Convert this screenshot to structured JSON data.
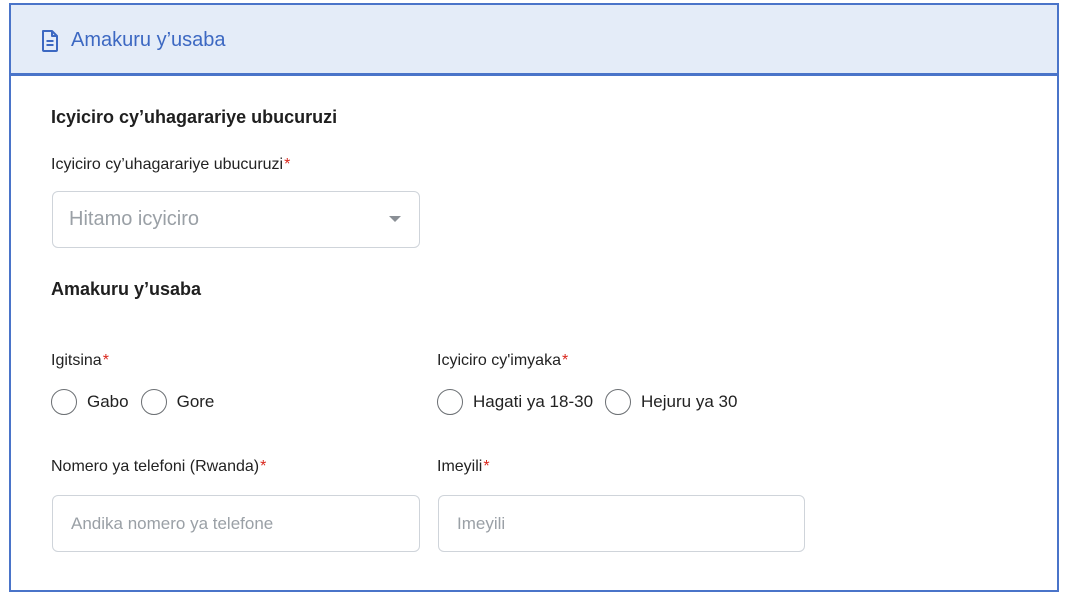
{
  "header": {
    "title": "Amakuru y’usaba",
    "icon": "document-icon",
    "accent_color": "#4a74c9",
    "background_color": "#e4ecf8"
  },
  "section_sector": {
    "title": "Icyiciro cy’uhagarariye ubucuruzi",
    "field_label": "Icyiciro cy’uhagarariye ubucuruzi",
    "required_mark": "*",
    "select_placeholder": "Hitamo icyiciro"
  },
  "section_applicant": {
    "title": "Amakuru y’usaba",
    "gender": {
      "label": "Igitsina",
      "required_mark": "*",
      "options": [
        "Gabo",
        "Gore"
      ]
    },
    "age_group": {
      "label": "Icyiciro cy'imyaka",
      "required_mark": "*",
      "options": [
        "Hagati ya 18-30",
        "Hejuru ya 30"
      ]
    },
    "phone": {
      "label": "Nomero ya telefoni (Rwanda)",
      "required_mark": "*",
      "placeholder": "Andika nomero ya telefone"
    },
    "email": {
      "label": "Imeyili",
      "required_mark": "*",
      "placeholder": "Imeyili"
    }
  },
  "colors": {
    "required": "#d9261c",
    "placeholder": "#9aa0a6",
    "input_border": "#cfd4da"
  }
}
